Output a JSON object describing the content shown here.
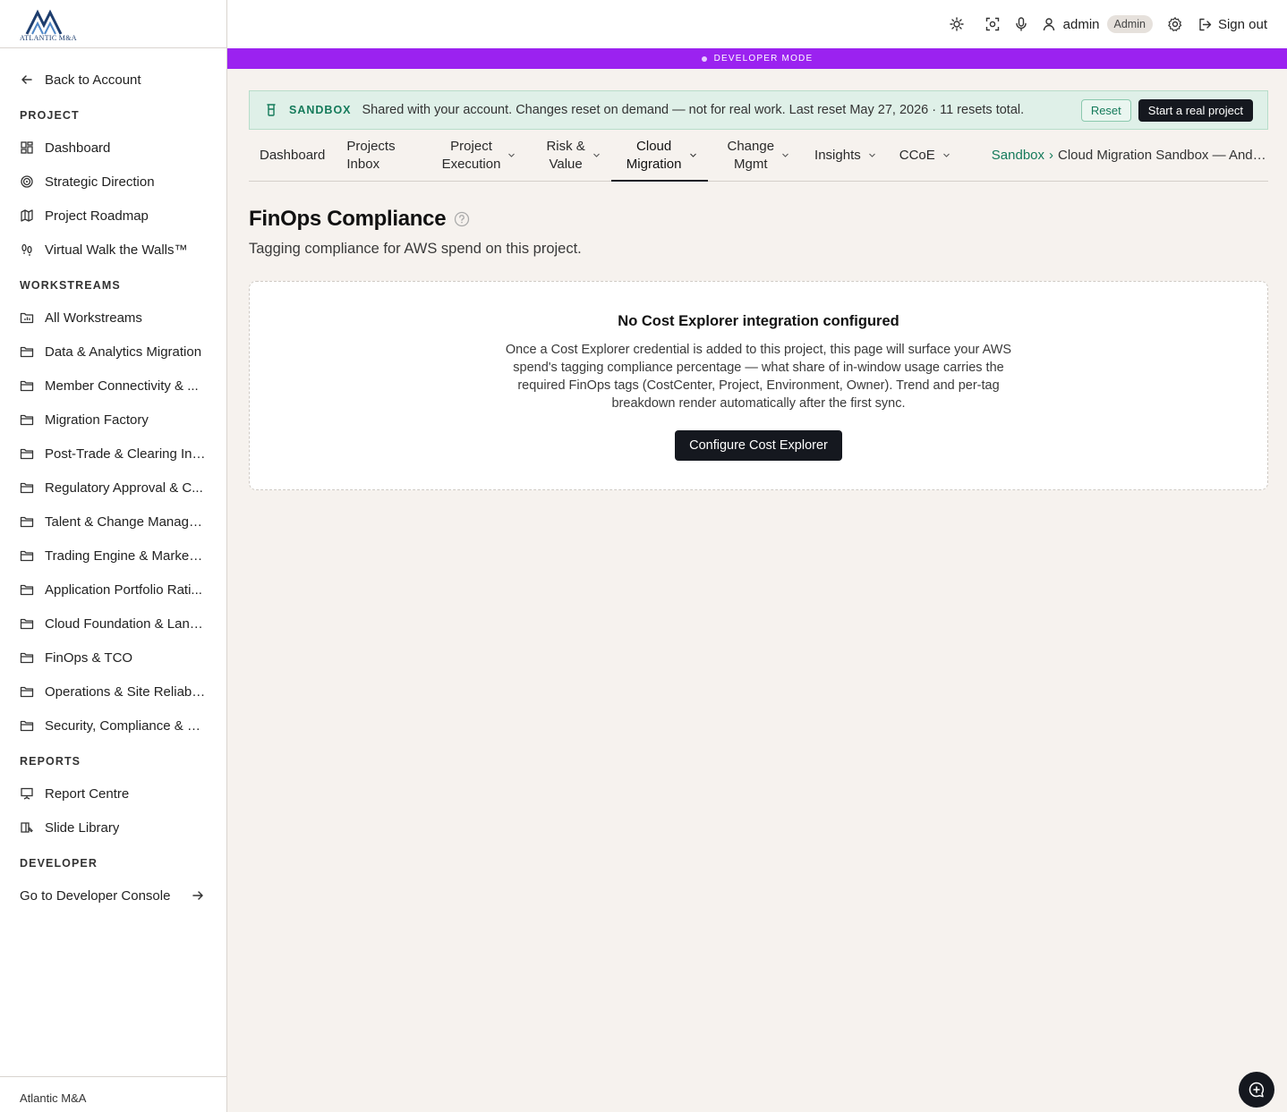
{
  "brand": {
    "logo_text": "ATLANTIC M&A",
    "footer": "Atlantic M&A"
  },
  "sidebar": {
    "back": {
      "label": "Back to Account",
      "icon": "arrow-left-icon"
    },
    "sections": {
      "project": {
        "title": "PROJECT",
        "items": [
          {
            "label": "Dashboard",
            "icon": "dashboard-icon"
          },
          {
            "label": "Strategic Direction",
            "icon": "target-icon"
          },
          {
            "label": "Project Roadmap",
            "icon": "map-icon"
          },
          {
            "label": "Virtual Walk the Walls™",
            "icon": "footprints-icon"
          }
        ]
      },
      "workstreams": {
        "title": "WORKSTREAMS",
        "items": [
          {
            "label": "All Workstreams",
            "icon": "folder-chart-icon"
          },
          {
            "label": "Data & Analytics Migration",
            "icon": "folder-icon"
          },
          {
            "label": "Member Connectivity & ...",
            "icon": "folder-icon"
          },
          {
            "label": "Migration Factory",
            "icon": "folder-icon"
          },
          {
            "label": "Post-Trade & Clearing Int...",
            "icon": "folder-icon"
          },
          {
            "label": "Regulatory Approval & C...",
            "icon": "folder-icon"
          },
          {
            "label": "Talent & Change Manage...",
            "icon": "folder-icon"
          },
          {
            "label": "Trading Engine & Market ...",
            "icon": "folder-icon"
          },
          {
            "label": "Application Portfolio Rati...",
            "icon": "folder-icon"
          },
          {
            "label": "Cloud Foundation & Land...",
            "icon": "folder-icon"
          },
          {
            "label": "FinOps & TCO",
            "icon": "folder-icon"
          },
          {
            "label": "Operations & Site Reliabil...",
            "icon": "folder-icon"
          },
          {
            "label": "Security, Compliance & R...",
            "icon": "folder-icon"
          }
        ]
      },
      "reports": {
        "title": "REPORTS",
        "items": [
          {
            "label": "Report Centre",
            "icon": "presentation-icon"
          },
          {
            "label": "Slide Library",
            "icon": "book-icon"
          }
        ]
      },
      "developer": {
        "title": "DEVELOPER",
        "link": "Go to Developer Console"
      }
    }
  },
  "topbar": {
    "user": "admin",
    "role": "Admin",
    "signout": "Sign out"
  },
  "devbar": {
    "label": "DEVELOPER MODE"
  },
  "sandbox": {
    "label": "SANDBOX",
    "text": "Shared with your account. Changes reset on demand — not for real work. Last reset May 27, 2026 · 11 resets total.",
    "reset": "Reset",
    "real": "Start a real project"
  },
  "tabs": [
    {
      "line1": "Dashboard"
    },
    {
      "line1": "Projects",
      "line2": "Inbox"
    },
    {
      "line1": "Project",
      "line2": "Execution",
      "dropdown": true
    },
    {
      "line1": "Risk &",
      "line2": "Value",
      "dropdown": true
    },
    {
      "line1": "Cloud",
      "line2": "Migration",
      "dropdown": true,
      "active": true
    },
    {
      "line1": "Change",
      "line2": "Mgmt",
      "dropdown": true
    },
    {
      "line1": "Insights",
      "dropdown": true
    },
    {
      "line1": "CCoE",
      "dropdown": true
    }
  ],
  "breadcrumb": {
    "root": "Sandbox",
    "sep": "›",
    "current": "Cloud Migration Sandbox — Andin..."
  },
  "page": {
    "title": "FinOps Compliance",
    "subtitle": "Tagging compliance for AWS spend on this project."
  },
  "empty": {
    "title": "No Cost Explorer integration configured",
    "desc": "Once a Cost Explorer credential is added to this project, this page will surface your AWS spend's tagging compliance percentage — what share of in-window usage carries the required FinOps tags (CostCenter, Project, Environment, Owner). Trend and per-tag breakdown render automatically after the first sync.",
    "button": "Configure Cost Explorer"
  },
  "colors": {
    "accent_purple": "#9b22f0",
    "sandbox_green": "#147a5a",
    "dark": "#15181f"
  }
}
